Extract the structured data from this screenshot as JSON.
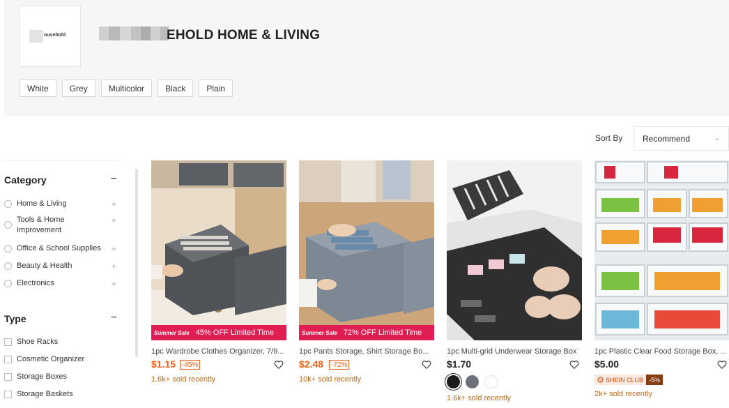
{
  "store": {
    "logo_text": "ousehold",
    "name": "EHOLD HOME & LIVING",
    "tags": [
      "White",
      "Grey",
      "Multicolor",
      "Black",
      "Plain"
    ]
  },
  "sort": {
    "label": "Sort By",
    "value": "Recommend"
  },
  "sidebar": {
    "category": {
      "title": "Category",
      "toggle": "−",
      "items": [
        "Home & Living",
        "Tools & Home Improvement",
        "Office & School Supplies",
        "Beauty & Health",
        "Electronics"
      ]
    },
    "type": {
      "title": "Type",
      "toggle": "−",
      "items": [
        "Shoe Racks",
        "Cosmetic Organizer",
        "Storage Boxes",
        "Storage Baskets"
      ]
    }
  },
  "products": [
    {
      "title": "1pc Wardrobe Clothes Organizer, 7/9...",
      "price": "$1.15",
      "discount": "-45%",
      "sold": "1.6k+ sold recently",
      "promo_tag": "Summer Sale",
      "promo_text": "45% OFF Limited Time"
    },
    {
      "title": "1pc Pants Storage, Shirt Storage Bo...",
      "price": "$2.48",
      "discount": "-72%",
      "sold": "10k+ sold recently",
      "promo_tag": "Summer Sale",
      "promo_text": "72% OFF Limited Time"
    },
    {
      "title": "1pc Multi-grid Underwear Storage Box",
      "price": "$1.70",
      "sold": "1.6k+ sold recently",
      "swatches": [
        "#1c1c1c",
        "#6b7079",
        "#ffffff"
      ]
    },
    {
      "title": "1pc Plastic Clear Food Storage Box, ...",
      "price": "$5.00",
      "sold": "2k+ sold recently",
      "club_label": "SHEIN CLUB",
      "club_discount": "-5%"
    }
  ],
  "colors": {
    "sale_price": "#f0601a",
    "promo_bar": "#e01e54",
    "sold_text": "#b86a1c"
  }
}
